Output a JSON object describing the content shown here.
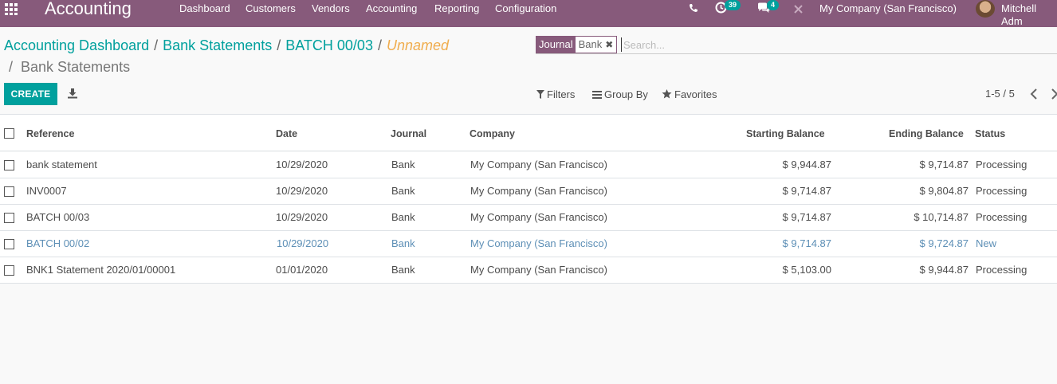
{
  "navbar": {
    "app_title": "Accounting",
    "menu": [
      "Dashboard",
      "Customers",
      "Vendors",
      "Accounting",
      "Reporting",
      "Configuration"
    ],
    "activity_count": "39",
    "message_count": "4",
    "company": "My Company (San Francisco)",
    "user": "Mitchell Adm"
  },
  "breadcrumb": {
    "items": [
      "Accounting Dashboard",
      "Bank Statements",
      "BATCH 00/03"
    ],
    "unnamed": "Unnamed",
    "current": "Bank Statements",
    "separator": "/"
  },
  "search": {
    "facet_label": "Journal",
    "facet_value": "Bank",
    "facet_remove": "✖",
    "placeholder": "Search..."
  },
  "toolbar": {
    "create_label": "CREATE",
    "filters_label": "Filters",
    "group_by_label": "Group By",
    "favorites_label": "Favorites",
    "pager": "1-5 / 5"
  },
  "table": {
    "columns": [
      "Reference",
      "Date",
      "Journal",
      "Company",
      "Starting Balance",
      "Ending Balance",
      "Status"
    ],
    "rows": [
      {
        "reference": "bank statement",
        "date": "10/29/2020",
        "journal": "Bank",
        "company": "My Company (San Francisco)",
        "starting": "$ 9,944.87",
        "ending": "$ 9,714.87",
        "status": "Processing"
      },
      {
        "reference": "INV0007",
        "date": "10/29/2020",
        "journal": "Bank",
        "company": "My Company (San Francisco)",
        "starting": "$ 9,714.87",
        "ending": "$ 9,804.87",
        "status": "Processing"
      },
      {
        "reference": "BATCH 00/03",
        "date": "10/29/2020",
        "journal": "Bank",
        "company": "My Company (San Francisco)",
        "starting": "$ 9,714.87",
        "ending": "$ 10,714.87",
        "status": "Processing"
      },
      {
        "reference": "BATCH 00/02",
        "date": "10/29/2020",
        "journal": "Bank",
        "company": "My Company (San Francisco)",
        "starting": "$ 9,714.87",
        "ending": "$ 9,724.87",
        "status": "New"
      },
      {
        "reference": "BNK1 Statement 2020/01/00001",
        "date": "01/01/2020",
        "journal": "Bank",
        "company": "My Company (San Francisco)",
        "starting": "$ 5,103.00",
        "ending": "$ 9,944.87",
        "status": "Processing"
      }
    ]
  },
  "colors": {
    "brand": "#875a7b",
    "accent": "#00a09d",
    "unnamed": "#f0ad4e",
    "new_row": "#5d8fb6"
  }
}
